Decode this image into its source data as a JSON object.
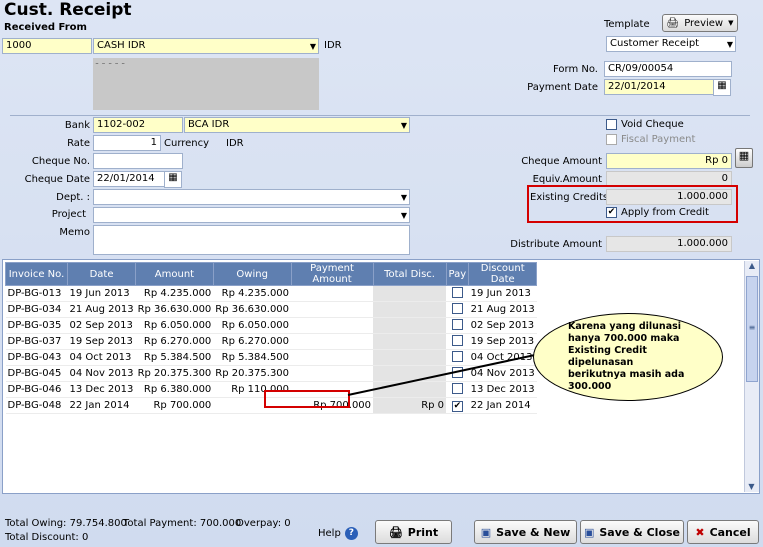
{
  "title": "Cust. Receipt",
  "received_from_label": "Received From",
  "customer_id": "1000",
  "customer_name": "CASH IDR",
  "currency_code": "IDR",
  "template_label": "Template",
  "preview_label": "Preview",
  "template_value": "Customer Receipt",
  "form_no_label": "Form No.",
  "form_no": "CR/09/00054",
  "payment_date_label": "Payment Date",
  "payment_date": "22/01/2014",
  "bank_label": "Bank",
  "bank_code": "1102-002",
  "bank_name": "BCA IDR",
  "rate_label": "Rate",
  "rate": "1",
  "currency_label": "Currency",
  "currency": "IDR",
  "cheque_no_label": "Cheque No.",
  "cheque_date_label": "Cheque Date",
  "cheque_date": "22/01/2014",
  "dept_label": "Dept. :",
  "project_label": "Project",
  "memo_label": "Memo",
  "void_cheque_label": "Void Cheque",
  "fiscal_payment_label": "Fiscal Payment",
  "cheque_amount_label": "Cheque Amount",
  "cheque_amount": "Rp 0",
  "equiv_amount_label": "Equiv.Amount",
  "equiv_amount": "0",
  "existing_credits_label": "Existing Credits",
  "existing_credits": "1.000.000",
  "apply_from_credit_label": "Apply from Credit",
  "distribute_amount_label": "Distribute Amount",
  "distribute_amount": "1.000.000",
  "columns": [
    "Invoice No.",
    "Date",
    "Amount",
    "Owing",
    "Payment Amount",
    "Total Disc.",
    "Pay",
    "Discount Date"
  ],
  "rows": [
    {
      "inv": "DP-BG-013",
      "date": "19 Jun 2013",
      "amount": "Rp 4.235.000",
      "owing": "Rp 4.235.000",
      "pay_amt": "",
      "disc": "",
      "checked": false,
      "disc_date": "19 Jun 2013"
    },
    {
      "inv": "DP-BG-034",
      "date": "21 Aug 2013",
      "amount": "Rp 36.630.000",
      "owing": "Rp 36.630.000",
      "pay_amt": "",
      "disc": "",
      "checked": false,
      "disc_date": "21 Aug 2013"
    },
    {
      "inv": "DP-BG-035",
      "date": "02 Sep 2013",
      "amount": "Rp 6.050.000",
      "owing": "Rp 6.050.000",
      "pay_amt": "",
      "disc": "",
      "checked": false,
      "disc_date": "02 Sep 2013"
    },
    {
      "inv": "DP-BG-037",
      "date": "19 Sep 2013",
      "amount": "Rp 6.270.000",
      "owing": "Rp 6.270.000",
      "pay_amt": "",
      "disc": "",
      "checked": false,
      "disc_date": "19 Sep 2013"
    },
    {
      "inv": "DP-BG-043",
      "date": "04 Oct 2013",
      "amount": "Rp 5.384.500",
      "owing": "Rp 5.384.500",
      "pay_amt": "",
      "disc": "",
      "checked": false,
      "disc_date": "04 Oct 2013"
    },
    {
      "inv": "DP-BG-045",
      "date": "04 Nov 2013",
      "amount": "Rp 20.375.300",
      "owing": "Rp 20.375.300",
      "pay_amt": "",
      "disc": "",
      "checked": false,
      "disc_date": "04 Nov 2013"
    },
    {
      "inv": "DP-BG-046",
      "date": "13 Dec 2013",
      "amount": "Rp 6.380.000",
      "owing": "Rp 110.000",
      "pay_amt": "",
      "disc": "",
      "checked": false,
      "disc_date": "13 Dec 2013"
    },
    {
      "inv": "DP-BG-048",
      "date": "22 Jan 2014",
      "amount": "Rp 700.000",
      "owing": "",
      "pay_amt": "Rp 700.000",
      "disc": "Rp 0",
      "checked": true,
      "disc_date": "22 Jan 2014"
    }
  ],
  "callout_text": "Karena yang dilunasi hanya 700.000 maka Existing Credit dipelunasan berikutnya masih ada 300.000",
  "total_owing": "Total Owing: 79.754.800",
  "total_payment": "Total Payment: 700.000",
  "overpay": "Overpay: 0",
  "total_discount": "Total Discount: 0",
  "help_label": "Help",
  "print_label": "Print",
  "save_new_label": "Save & New",
  "save_close_label": "Save & Close",
  "cancel_label": "Cancel"
}
